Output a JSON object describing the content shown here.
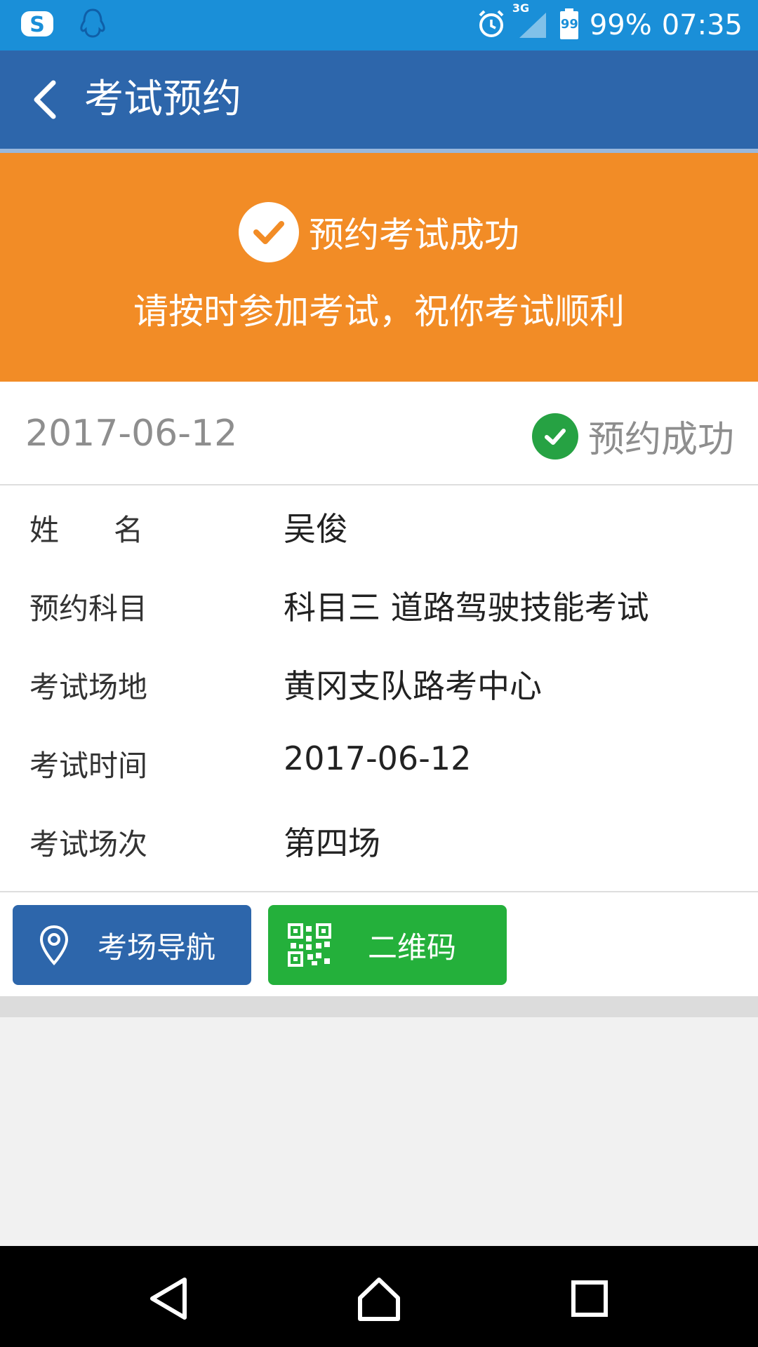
{
  "status_bar": {
    "network": "3G",
    "battery_level": "99",
    "battery_percent": "99%",
    "time": "07:35"
  },
  "app_bar": {
    "title": "考试预约"
  },
  "banner": {
    "title": "预约考试成功",
    "subtitle": "请按时参加考试，祝你考试顺利",
    "color": "#f28c26"
  },
  "summary": {
    "date": "2017-06-12",
    "status": "预约成功",
    "status_color": "#26a243"
  },
  "details": [
    {
      "label": "姓名",
      "value": "吴俊"
    },
    {
      "label": "预约科目",
      "value": "科目三 道路驾驶技能考试"
    },
    {
      "label": "考试场地",
      "value": "黄冈支队路考中心"
    },
    {
      "label": "考试时间",
      "value": "2017-06-12"
    },
    {
      "label": "考试场次",
      "value": "第四场"
    }
  ],
  "buttons": {
    "navigation": {
      "label": "考场导航",
      "icon": "location-pin-icon",
      "color": "#2d66ab"
    },
    "qrcode": {
      "label": "二维码",
      "icon": "qr-code-icon",
      "color": "#24b03b"
    }
  },
  "nav_bar": {
    "back_icon": "triangle-back-icon",
    "home_icon": "home-icon",
    "recents_icon": "square-recents-icon"
  }
}
